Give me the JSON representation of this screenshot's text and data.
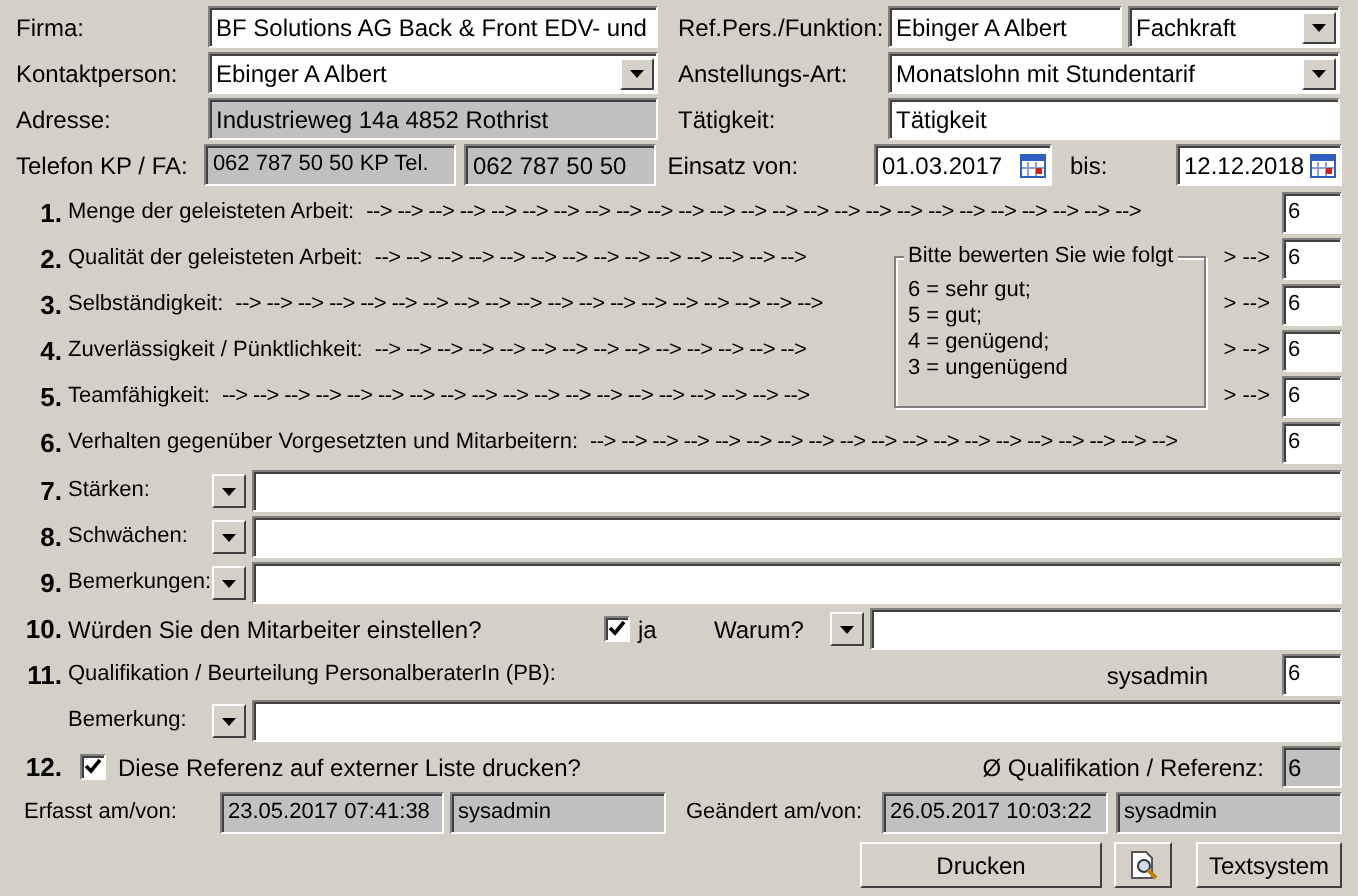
{
  "header_rows": [
    {
      "left": {
        "label": "Firma:",
        "fields": [
          {
            "kind": "text",
            "value": "BF Solutions AG Back & Front EDV- und"
          }
        ]
      },
      "right": {
        "label": "Ref.Pers./Funktion:",
        "fields": [
          {
            "kind": "text",
            "value": "Ebinger A Albert"
          },
          {
            "kind": "dropdown",
            "value": "Fachkraft"
          }
        ]
      }
    },
    {
      "left": {
        "label": "Kontaktperson:",
        "fields": [
          {
            "kind": "dropdown",
            "value": "Ebinger A Albert"
          }
        ]
      },
      "right": {
        "label": "Anstellungs-Art:",
        "fields": [
          {
            "kind": "dropdown",
            "value": "Monatslohn mit Stundentarif"
          }
        ]
      }
    },
    {
      "left": {
        "label": "Adresse:",
        "fields": [
          {
            "kind": "readonly",
            "value": "Industrieweg 14a 4852 Rothrist"
          }
        ]
      },
      "right": {
        "label": "Tätigkeit:",
        "fields": [
          {
            "kind": "text",
            "value": "Tätigkeit"
          }
        ]
      }
    },
    {
      "left": {
        "label": "Telefon KP / FA:",
        "fields": [
          {
            "kind": "readonly",
            "value": "062 787 50 50 KP Tel."
          },
          {
            "kind": "readonly",
            "value": "062 787 50 50"
          }
        ]
      },
      "right": {
        "label": "Einsatz von:",
        "fields": [
          {
            "kind": "date",
            "value": "01.03.2017"
          },
          {
            "kind": "label",
            "value": "bis:"
          },
          {
            "kind": "date",
            "value": "12.12.2018"
          }
        ]
      }
    }
  ],
  "ratings": [
    {
      "number": "1.",
      "label": "Menge der geleisteten Arbeit:",
      "arrows_before": "--> --> --> --> --> --> --> --> --> --> --> --> --> --> --> --> --> --> --> --> --> --> --> --> -->",
      "value": "6"
    },
    {
      "number": "2.",
      "label": "Qualität der geleisteten Arbeit:",
      "arrows_before": "--> --> --> --> --> --> --> --> --> --> --> --> --> -->",
      "arrows_after": "> -->",
      "value": "6"
    },
    {
      "number": "3.",
      "label": "Selbständigkeit:",
      "arrows_before": "--> --> --> --> --> --> --> --> --> --> --> --> --> --> --> --> --> --> -->",
      "arrows_after": "> -->",
      "value": "6"
    },
    {
      "number": "4.",
      "label": "Zuverlässigkeit / Pünktlichkeit:",
      "arrows_before": "--> --> --> --> --> --> --> --> --> --> --> --> --> -->",
      "arrows_after": "> -->",
      "value": "6"
    },
    {
      "number": "5.",
      "label": "Teamfähigkeit:",
      "arrows_before": "--> --> --> --> --> --> --> --> --> --> --> --> --> --> --> --> --> --> -->",
      "arrows_after": "> -->",
      "value": "6"
    },
    {
      "number": "6.",
      "label": "Verhalten gegenüber Vorgesetzten und Mitarbeitern:",
      "arrows_before": "--> --> --> --> --> --> --> --> --> --> --> --> --> --> --> --> --> --> -->",
      "value": "6"
    }
  ],
  "legend": {
    "title": "Bitte bewerten Sie wie folgt",
    "lines": [
      "6 = sehr gut;",
      "5 = gut;",
      "4 = genügend;",
      "3 = ungenügend"
    ]
  },
  "comment_rows": [
    {
      "number": "7.",
      "label": "Stärken:"
    },
    {
      "number": "8.",
      "label": "Schwächen:"
    },
    {
      "number": "9.",
      "label": "Bemerkungen:"
    }
  ],
  "hire": {
    "number": "10.",
    "question": "Würden Sie den Mitarbeiter einstellen?",
    "checked": true,
    "checkbox_label": "ja",
    "why_label": "Warum?"
  },
  "qualification": {
    "number": "11.",
    "label": "Qualifikation / Beurteilung PersonalberaterIn (PB):",
    "user": "sysadmin",
    "value": "6",
    "remark_label": "Bemerkung:"
  },
  "print_option": {
    "number": "12.",
    "checked": true,
    "label": "Diese Referenz auf externer Liste drucken?",
    "average_label": "Ø Qualifikation / Referenz:",
    "average_value": "6"
  },
  "audit": {
    "created_label": "Erfasst am/von:",
    "created_at": "23.05.2017 07:41:38",
    "created_by": "sysadmin",
    "changed_label": "Geändert am/von:",
    "changed_at": "26.05.2017 10:03:22",
    "changed_by": "sysadmin"
  },
  "buttons": [
    {
      "kind": "text",
      "label": "Drucken"
    },
    {
      "kind": "preview"
    },
    {
      "kind": "text",
      "label": "Textsystem"
    }
  ]
}
